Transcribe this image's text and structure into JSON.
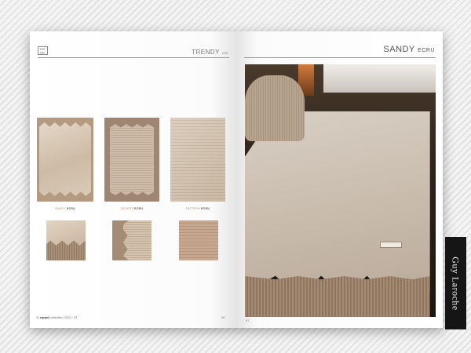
{
  "left_page": {
    "header": {
      "collection": "TRENDY",
      "collection_sub": "UNI"
    },
    "rugs": [
      {
        "name": "SANDY",
        "color": "ECRU"
      },
      {
        "name": "DESERT",
        "color": "ECRU"
      },
      {
        "name": "PATTERN",
        "color": "ECRU"
      }
    ],
    "footer": {
      "brand": "carpet",
      "text": "collection 2012 / 13",
      "page": "96"
    }
  },
  "right_page": {
    "title": {
      "name": "SANDY",
      "color": "ECRU"
    },
    "page": "97"
  },
  "brand_strip": {
    "text": "Guy Laroche"
  },
  "colors": {
    "rug_beige": "#c9b9a6",
    "floor_dark": "#2a1f17",
    "strip_black": "#151515"
  }
}
